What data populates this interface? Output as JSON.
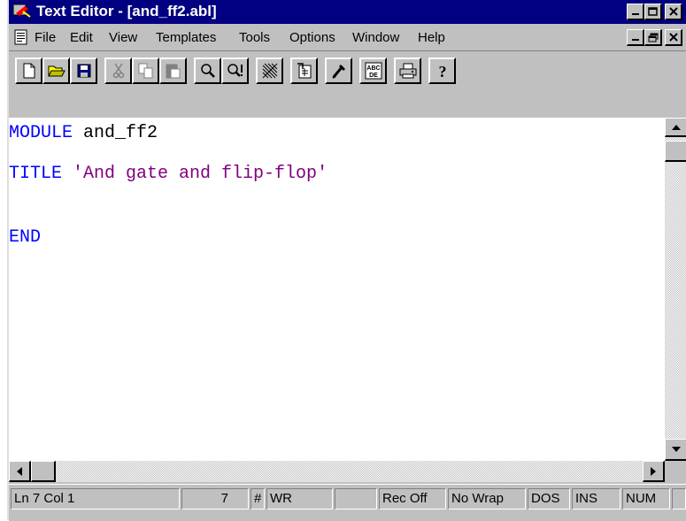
{
  "window": {
    "title": "Text Editor - [and_ff2.abl]",
    "title_buttons": [
      "_",
      "□",
      "×"
    ],
    "mdi_buttons": [
      "_",
      "🗗",
      "×"
    ]
  },
  "menu": {
    "items": [
      "File",
      "Edit",
      "View",
      "Templates",
      "Tools",
      "Options",
      "Window",
      "Help"
    ]
  },
  "toolbar": {
    "buttons": [
      "new-file-icon",
      "open-folder-icon",
      "save-icon",
      "cut-icon",
      "copy-icon",
      "paste-icon",
      "find-icon",
      "find-next-icon",
      "hatch-icon",
      "insert-template-icon",
      "edit-tool-icon",
      "abc-de-icon",
      "print-icon",
      "help-icon"
    ]
  },
  "editor": {
    "lines": [
      {
        "keyword": "MODULE",
        "rest": " and_ff2"
      },
      {
        "keyword": "TITLE",
        "string": " 'And gate and flip-flop'"
      },
      {
        "keyword": "END"
      }
    ]
  },
  "status": {
    "position": "Ln 7 Col 1",
    "number": "7",
    "hash": "#",
    "mode": "WR",
    "rec": "Rec Off",
    "wrap": "No Wrap",
    "format": "DOS",
    "insert": "INS",
    "num": "NUM"
  },
  "colors": {
    "title_bar": "#000080",
    "keyword": "#0000ff",
    "string": "#800080",
    "chrome": "#c0c0c0"
  }
}
